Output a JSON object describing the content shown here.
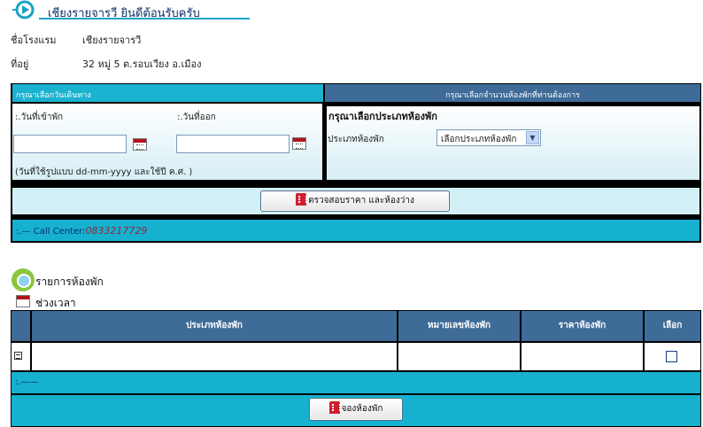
{
  "header": {
    "title": "เชียงรายจารวี ยินดีต้อนรับครับ"
  },
  "hotel_info": {
    "name_label": "ชื่อโรงแรม",
    "name_value": "เชียงรายจารวี",
    "address_label": "ที่อยู่",
    "address_value": "32 หมู่ 5 ต.รอบเวียง อ.เมือง"
  },
  "booking_form": {
    "left_header": "กรุณาเลือกวันเดินทาง",
    "right_header": "กรุณาเลือกจำนวนห้องพักที่ท่านต้องการ",
    "checkin_label": ":.วันที่เข้าพัก",
    "checkout_label": ":.วันที่ออก",
    "checkin_value": "",
    "checkout_value": "",
    "date_hint": "(วันที่ใช้รูปแบบ dd-mm-yyyy และใช้ปี ค.ศ. )",
    "room_type_title": "กรุณาเลือกประเภทห้องพัก",
    "room_type_label": "ประเภทห้องพัก",
    "room_type_selected": "เลือกประเภทห้องพัก",
    "check_button": "ตรวจสอบราคา และห้องว่าง",
    "call_center_label": ":.— Call Center:",
    "call_center_phone": "0833217729"
  },
  "room_list": {
    "title": "รายการห้องพัก",
    "period_label": "ช่วงเวลา",
    "columns": [
      "ประเภทห้องพัก",
      "หมายเลขห้องพัก",
      "ราคาห้องพัก",
      "เลือก"
    ],
    "footer_text": ":.——",
    "book_button": "จองห้องพัก"
  },
  "colors": {
    "teal": "#16b1cf",
    "header_blue": "#3e6b98",
    "title_navy": "#0b2d66",
    "phone": "#8a2a3f"
  }
}
